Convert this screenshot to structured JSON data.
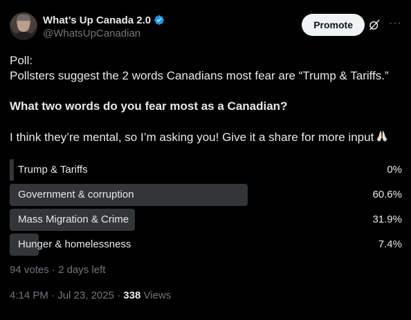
{
  "author": {
    "display_name": "What’s Up Canada 2.0",
    "handle": "@WhatsUpCanadian",
    "verified": true,
    "verified_color": "#1d9bf0"
  },
  "actions": {
    "promote_label": "Promote",
    "grok_icon": "grok-icon",
    "more_icon": "more-icon"
  },
  "tweet": {
    "line1": "Poll:",
    "line2": "Pollsters suggest the 2 words Canadians most fear are “Trump & Tariffs.”",
    "question": "What two words do you fear most as a Canadian?",
    "line4": "I think they’re mental, so I’m asking you! Give it a share for more input",
    "emoji_icon": "folded-hands-icon"
  },
  "poll": {
    "options": [
      {
        "label": "Trump & Tariffs",
        "percent_text": "0%",
        "percent": 0
      },
      {
        "label": "Government & corruption",
        "percent_text": "60.6%",
        "percent": 60.6
      },
      {
        "label": "Mass Migration & Crime",
        "percent_text": "31.9%",
        "percent": 31.9
      },
      {
        "label": "Hunger & homelessness",
        "percent_text": "7.4%",
        "percent": 7.4
      }
    ],
    "votes": "94 votes",
    "separator": "·",
    "time_left": "2 days left"
  },
  "meta": {
    "time": "4:14 PM",
    "date": "Jul 23, 2025",
    "separator": "·",
    "views_count": "338",
    "views_label": "Views"
  },
  "colors": {
    "background": "#000000",
    "text": "#e7e9ea",
    "muted": "#71767b",
    "poll_bar": "#333639",
    "button_bg": "#eff3f4"
  }
}
